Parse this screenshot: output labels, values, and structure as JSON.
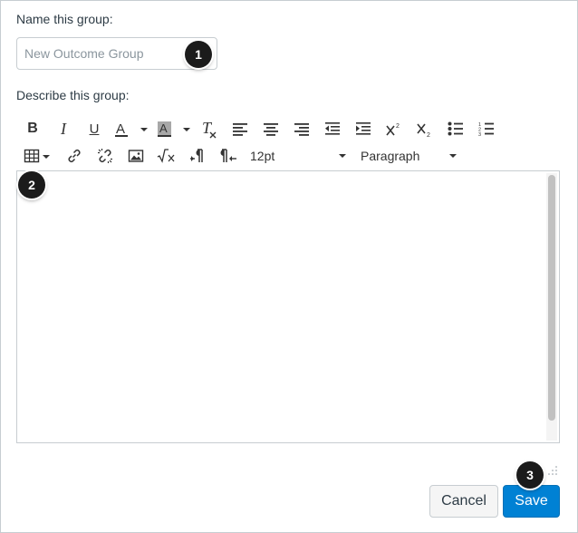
{
  "form": {
    "name_label": "Name this group:",
    "name_placeholder": "New Outcome Group",
    "describe_label": "Describe this group:"
  },
  "toolbar": {
    "row1": [
      "bold-icon",
      "italic-icon",
      "underline-icon",
      "text-color-icon",
      "background-color-icon",
      "clear-formatting-icon",
      "align-left-icon",
      "align-center-icon",
      "align-right-icon",
      "outdent-icon",
      "indent-icon",
      "superscript-icon",
      "subscript-icon",
      "bullet-list-icon",
      "numbered-list-icon"
    ],
    "row2": [
      "table-icon",
      "link-icon",
      "unlink-icon",
      "image-icon",
      "math-icon",
      "ltr-icon",
      "rtl-icon"
    ],
    "font_size": "12pt",
    "block_format": "Paragraph"
  },
  "callouts": {
    "one": "1",
    "two": "2",
    "three": "3"
  },
  "buttons": {
    "cancel": "Cancel",
    "save": "Save"
  },
  "colors": {
    "primary": "#0081d4",
    "callout": "#1b1b1b",
    "border": "#c7cdd1"
  }
}
